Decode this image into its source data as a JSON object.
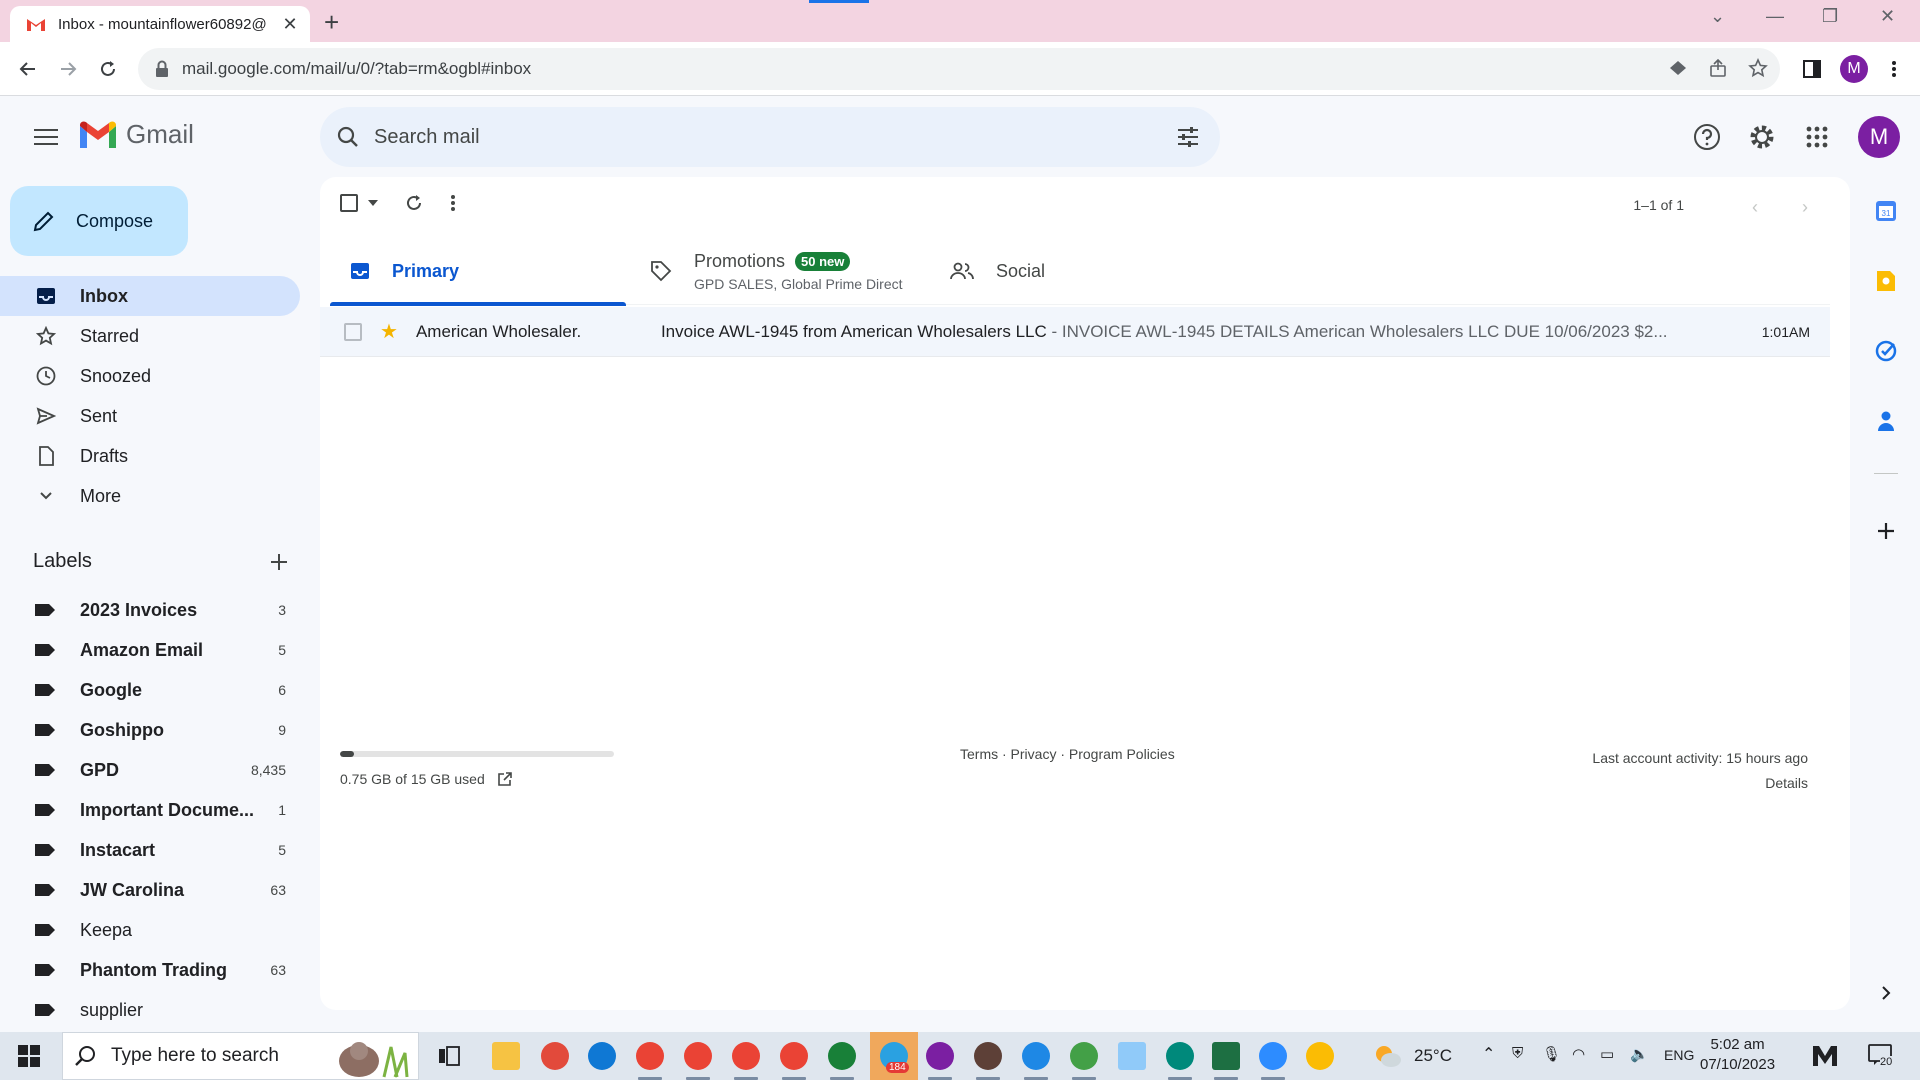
{
  "browser": {
    "tab_title": "Inbox - mountainflower60892@",
    "url": "mail.google.com/mail/u/0/?tab=rm&ogbl#inbox",
    "profile_initial": "M"
  },
  "gmail": {
    "logo_text": "Gmail",
    "search_placeholder": "Search mail",
    "account_initial": "M"
  },
  "sidebar": {
    "compose_label": "Compose",
    "nav": [
      {
        "label": "Inbox",
        "icon": "inbox-icon",
        "active": true
      },
      {
        "label": "Starred",
        "icon": "star-outline-icon"
      },
      {
        "label": "Snoozed",
        "icon": "clock-icon"
      },
      {
        "label": "Sent",
        "icon": "send-icon"
      },
      {
        "label": "Drafts",
        "icon": "draft-icon"
      },
      {
        "label": "More",
        "icon": "chevron-down-icon"
      }
    ],
    "labels_title": "Labels",
    "labels": [
      {
        "name": "2023 Invoices",
        "count": "3",
        "bold": true
      },
      {
        "name": "Amazon Email",
        "count": "5",
        "bold": true
      },
      {
        "name": "Google",
        "count": "6",
        "bold": true
      },
      {
        "name": "Goshippo",
        "count": "9",
        "bold": true
      },
      {
        "name": "GPD",
        "count": "8,435",
        "bold": true
      },
      {
        "name": "Important Docume...",
        "count": "1",
        "bold": true
      },
      {
        "name": "Instacart",
        "count": "5",
        "bold": true
      },
      {
        "name": "JW Carolina",
        "count": "63",
        "bold": true
      },
      {
        "name": "Keepa",
        "count": "",
        "bold": false
      },
      {
        "name": "Phantom Trading",
        "count": "63",
        "bold": true
      },
      {
        "name": "supplier",
        "count": "",
        "bold": false
      }
    ]
  },
  "main": {
    "page_count": "1–1 of 1",
    "tabs": {
      "primary": "Primary",
      "promotions": "Promotions",
      "promotions_badge": "50 new",
      "promotions_sub": "GPD SALES, Global Prime Direct",
      "social": "Social"
    },
    "emails": [
      {
        "sender": "American Wholesaler.",
        "subject": "Invoice AWL-1945 from American Wholesalers LLC",
        "snippet": " - INVOICE AWL-1945 DETAILS American Wholesalers LLC DUE 10/06/2023 $2...",
        "time": "1:01AM",
        "starred": true
      }
    ],
    "storage": {
      "text": "0.75 GB of 15 GB used",
      "fraction": 0.05
    },
    "footer": {
      "links": "Terms · Privacy · Program Policies",
      "activity": "Last account activity: 15 hours ago",
      "details": "Details"
    }
  },
  "taskbar": {
    "search_placeholder": "Type here to search",
    "telegram_badge": "184",
    "weather": "25°C",
    "language": "ENG",
    "time": "5:02 am",
    "date": "07/10/2023",
    "notification_count": "20"
  },
  "colors": {
    "tabstrip": "#f3d4e1",
    "compose": "#c2e7ff",
    "active_nav": "#d3e3fd",
    "primary_blue": "#0b57d0",
    "badge_green": "#188038",
    "avatar": "#7b1fa2"
  }
}
